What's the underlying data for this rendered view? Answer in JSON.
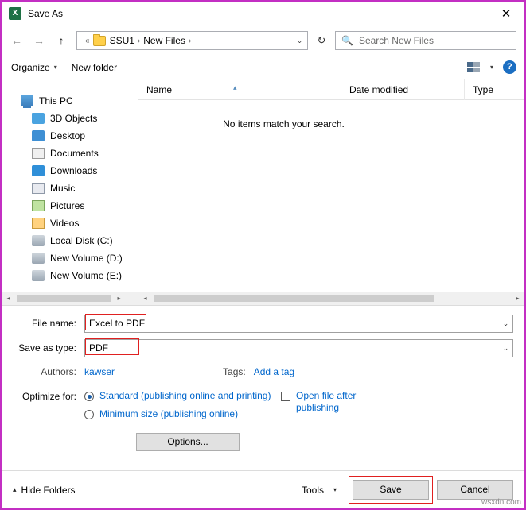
{
  "window": {
    "title": "Save As",
    "app_icon": "excel-icon",
    "close_label": "✕"
  },
  "nav": {
    "back": "←",
    "forward": "→",
    "up": "↑",
    "breadcrumb_prefix": "«",
    "breadcrumb": [
      "SSU1",
      "New Files"
    ],
    "separator": "›",
    "dropdown_caret": "⌄",
    "refresh": "↻",
    "search_placeholder": "Search New Files",
    "search_icon": "search-icon"
  },
  "toolbar": {
    "organize": "Organize",
    "organize_caret": "▾",
    "new_folder": "New folder",
    "view_caret": "▾",
    "help": "?"
  },
  "sidebar": {
    "items": [
      {
        "label": "This PC",
        "icon": "pc-icon",
        "indent": false
      },
      {
        "label": "3D Objects",
        "icon": "folder-icon",
        "indent": true
      },
      {
        "label": "Desktop",
        "icon": "desktop-icon",
        "indent": true
      },
      {
        "label": "Documents",
        "icon": "documents-icon",
        "indent": true
      },
      {
        "label": "Downloads",
        "icon": "downloads-icon",
        "indent": true
      },
      {
        "label": "Music",
        "icon": "music-icon",
        "indent": true
      },
      {
        "label": "Pictures",
        "icon": "pictures-icon",
        "indent": true
      },
      {
        "label": "Videos",
        "icon": "videos-icon",
        "indent": true
      },
      {
        "label": "Local Disk (C:)",
        "icon": "disk-icon",
        "indent": true
      },
      {
        "label": "New Volume (D:)",
        "icon": "disk-icon",
        "indent": true
      },
      {
        "label": "New Volume (E:)",
        "icon": "disk-icon",
        "indent": true
      }
    ],
    "scroll_left": "◂",
    "scroll_right": "▸"
  },
  "filelist": {
    "columns": [
      "Name",
      "Date modified",
      "Type"
    ],
    "sort_caret": "▴",
    "empty_message": "No items match your search.",
    "scroll_left": "◂",
    "scroll_right": "▸"
  },
  "form": {
    "file_name_label": "File name:",
    "file_name_value": "Excel to PDF",
    "save_as_type_label": "Save as type:",
    "save_as_type_value": "PDF",
    "combo_caret": "⌄",
    "authors_label": "Authors:",
    "authors_value": "kawser",
    "tags_label": "Tags:",
    "tags_value": "Add a tag",
    "optimize_label": "Optimize for:",
    "option_standard": "Standard (publishing online and printing)",
    "option_minimum": "Minimum size (publishing online)",
    "checkbox_open_after": "Open file after publishing",
    "options_button": "Options..."
  },
  "footer": {
    "hide_folders": "Hide Folders",
    "hide_folders_caret": "▴",
    "tools": "Tools",
    "tools_caret": "▾",
    "save": "Save",
    "cancel": "Cancel"
  },
  "watermark": "wsxdn.com",
  "colors": {
    "highlight_border": "#e02020",
    "dialog_border": "#c32fc3",
    "link": "#0066cc",
    "excel_green": "#1e7145"
  }
}
